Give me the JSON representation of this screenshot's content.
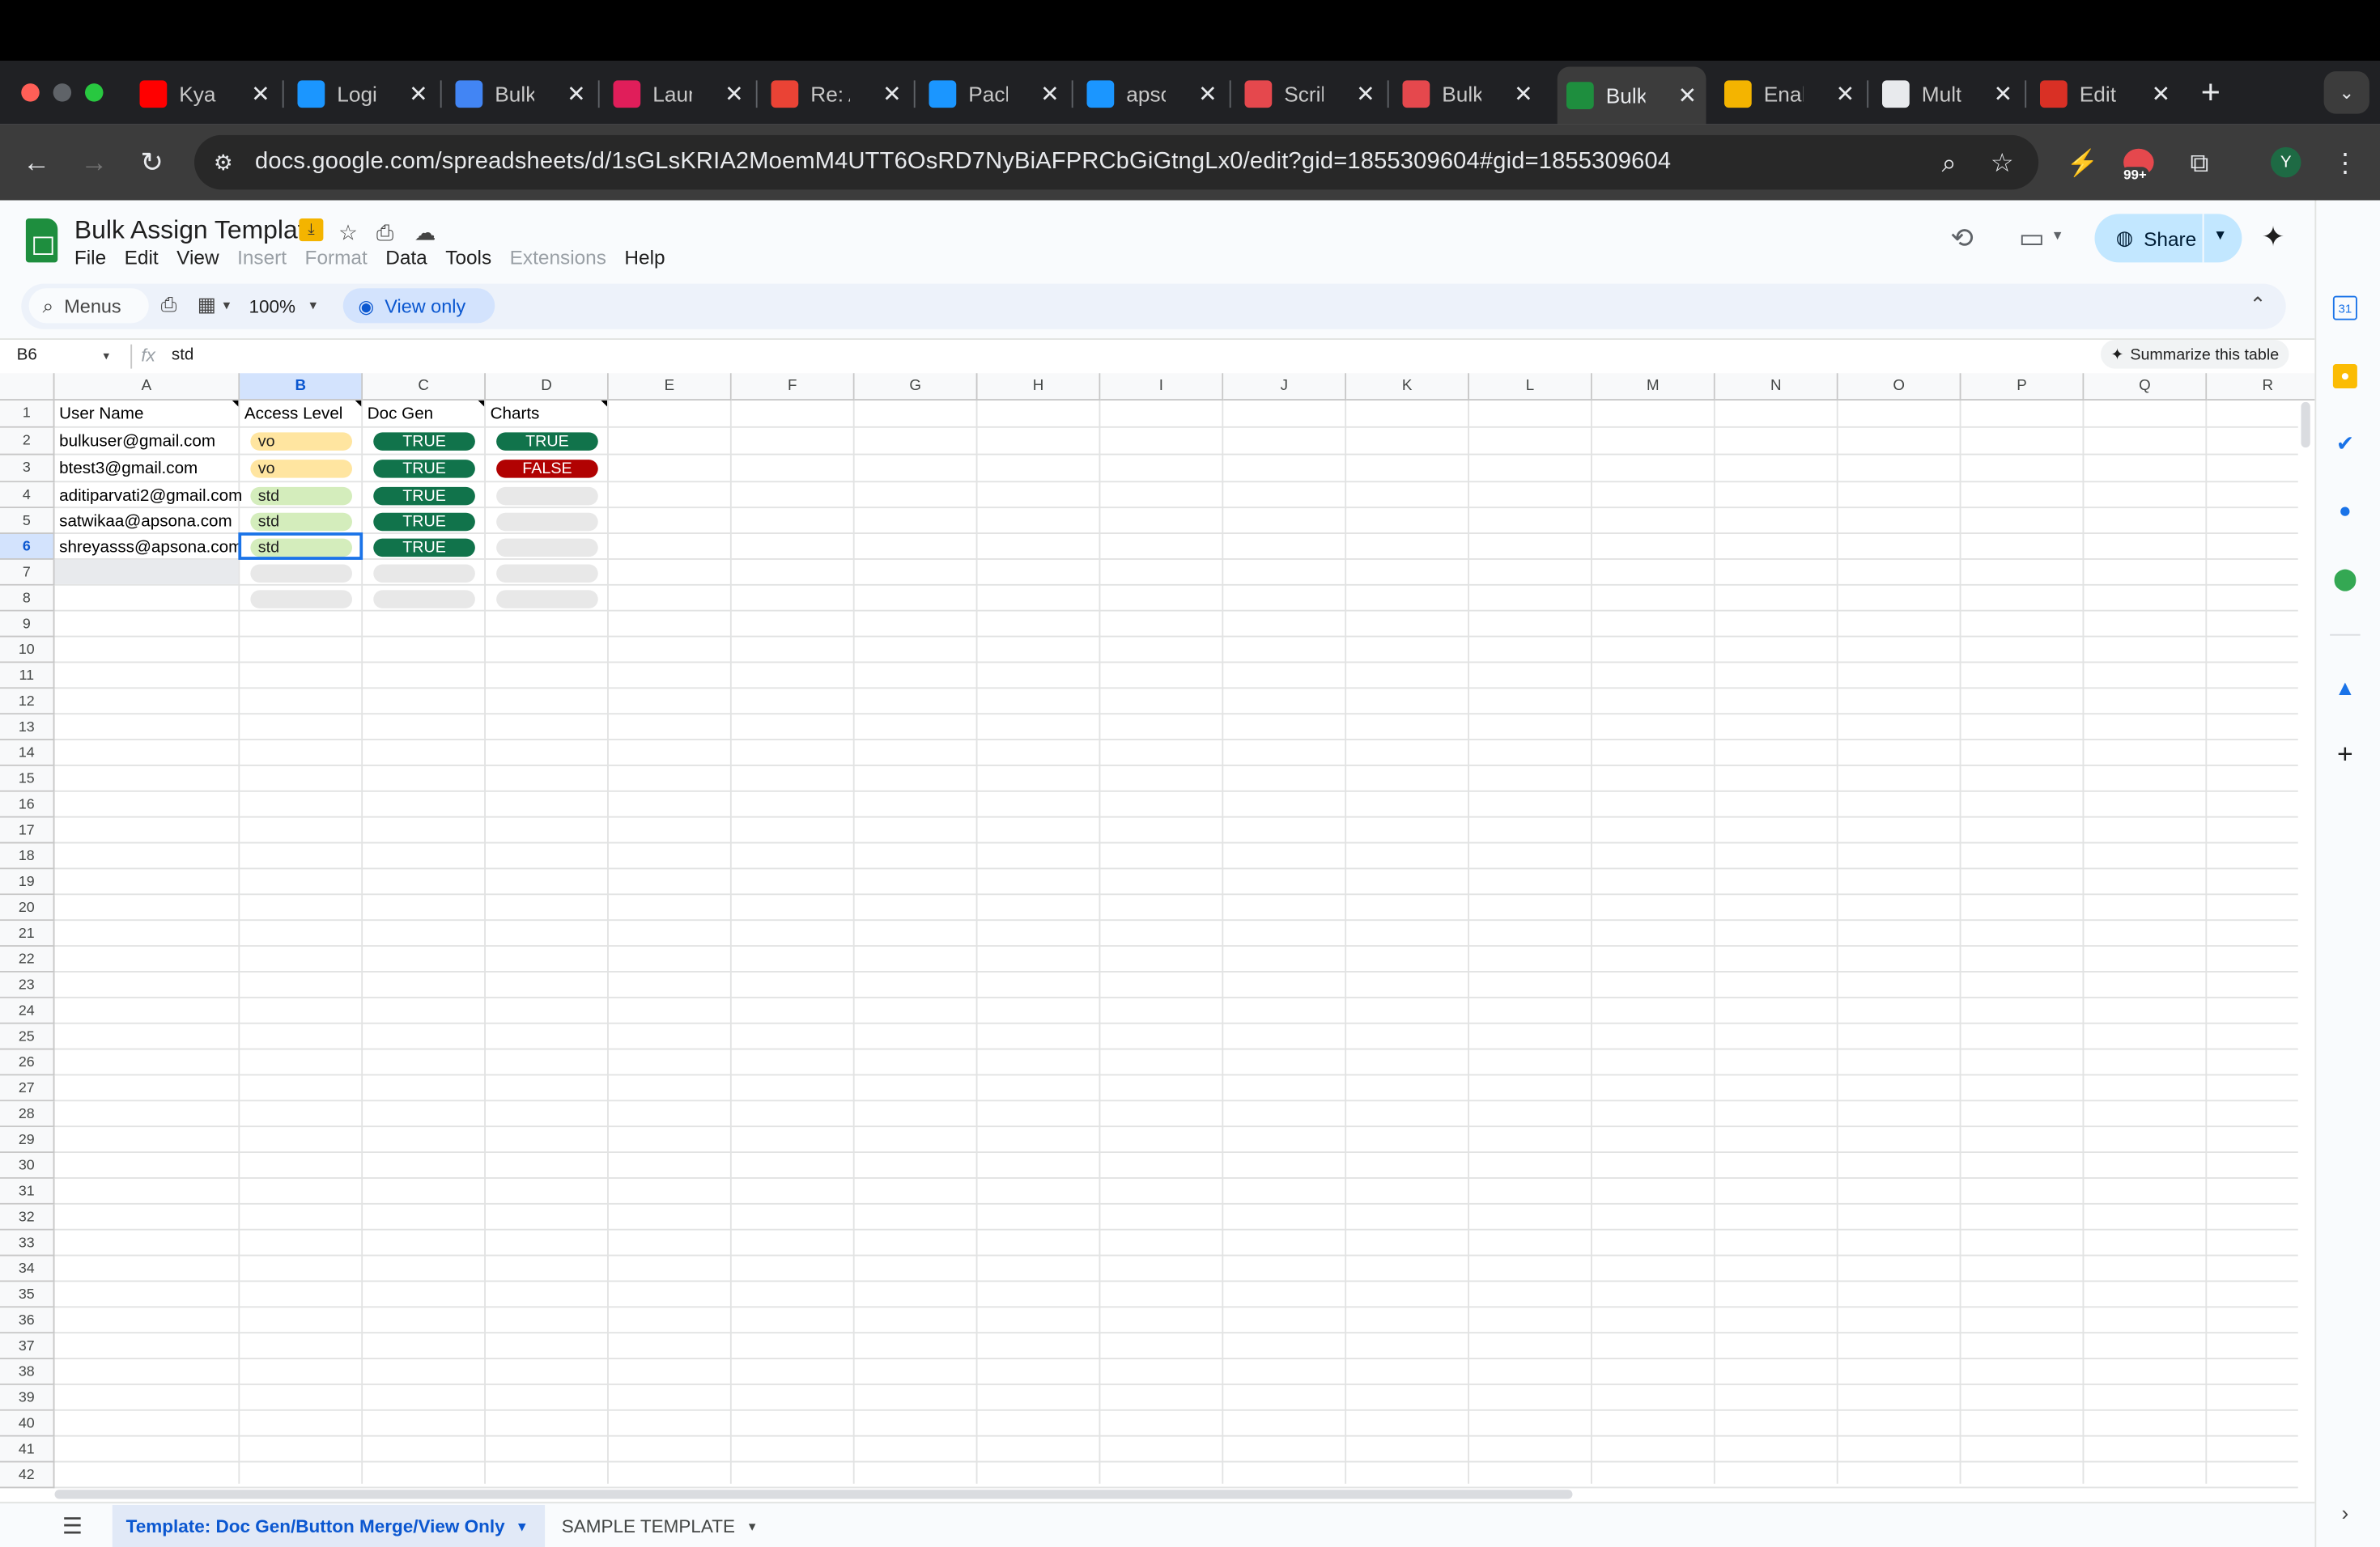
{
  "browser": {
    "tabs": [
      {
        "label": "Kya M",
        "icon": "youtube-icon",
        "color": "#ff0000"
      },
      {
        "label": "Login",
        "icon": "salesforce-cloud-icon",
        "color": "#1b96ff"
      },
      {
        "label": "Bulk",
        "icon": "google-docs-icon",
        "color": "#4285f4"
      },
      {
        "label": "Laun",
        "icon": "slack-icon",
        "color": "#e01e5a"
      },
      {
        "label": "Re: A",
        "icon": "gmail-icon",
        "color": "#ea4335"
      },
      {
        "label": "Pack",
        "icon": "salesforce-cloud-icon",
        "color": "#1b96ff"
      },
      {
        "label": "apso",
        "icon": "salesforce-cloud-icon",
        "color": "#1b96ff"
      },
      {
        "label": "Scrib",
        "icon": "scribe-icon",
        "color": "#e5484d"
      },
      {
        "label": "Bulk",
        "icon": "scribe-icon",
        "color": "#e5484d"
      },
      {
        "label": "Bulk",
        "icon": "google-sheets-icon",
        "color": "#1e8e3e"
      },
      {
        "label": "Enab",
        "icon": "google-slides-icon",
        "color": "#f4b400"
      },
      {
        "label": "Multi",
        "icon": "openai-icon",
        "color": "#e8eaed"
      },
      {
        "label": "Edit",
        "icon": "apsona-icon",
        "color": "#d93025"
      }
    ],
    "active_tab_index": 9,
    "url": "docs.google.com/spreadsheets/d/1sGLsKRIA2MoemM4UTT6OsRD7NyBiAFPRCbGiGtngLx0/edit?gid=1855309604#gid=1855309604",
    "extension_badge": "99+",
    "profile_initial": "Y"
  },
  "sheets": {
    "doc_title": "Bulk Assign Template",
    "menu": [
      "File",
      "Edit",
      "View",
      "Insert",
      "Format",
      "Data",
      "Tools",
      "Extensions",
      "Help"
    ],
    "menu_disabled": [
      "Insert",
      "Format",
      "Extensions"
    ],
    "search_label": "Menus",
    "zoom": "100%",
    "view_only_label": "View only",
    "share_label": "Share",
    "account_initial": "Y",
    "name_box": "B6",
    "formula_value": "std",
    "summarize_label": "Summarize this table",
    "selected_cell": "B6"
  },
  "grid": {
    "columns": [
      "A",
      "B",
      "C",
      "D",
      "E",
      "F",
      "G",
      "H",
      "I",
      "J",
      "K",
      "L",
      "M",
      "N",
      "O",
      "P",
      "Q",
      "R"
    ],
    "row_count": 42,
    "headers": [
      "User Name",
      "Access Level",
      "Doc Gen",
      "Charts"
    ],
    "rows": [
      {
        "user": "bulkuser@gmail.com",
        "access": "vo",
        "docgen": "TRUE",
        "charts": "TRUE"
      },
      {
        "user": "btest3@gmail.com",
        "access": "vo",
        "docgen": "TRUE",
        "charts": "FALSE"
      },
      {
        "user": "aditiparvati2@gmail.com",
        "access": "std",
        "docgen": "TRUE",
        "charts": ""
      },
      {
        "user": "satwikaa@apsona.com",
        "access": "std",
        "docgen": "TRUE",
        "charts": ""
      },
      {
        "user": "shreyasss@apsona.com",
        "access": "std",
        "docgen": "TRUE",
        "charts": ""
      }
    ],
    "colors": {
      "vo": "#ffe5a0",
      "std": "#d4edbc",
      "true": "#11734b",
      "false": "#b10202",
      "empty": "#e8e8e8"
    }
  },
  "sheet_tabs": [
    {
      "label": "Template: Doc Gen/Button Merge/View Only",
      "active": true
    },
    {
      "label": "SAMPLE TEMPLATE",
      "active": false
    }
  ]
}
